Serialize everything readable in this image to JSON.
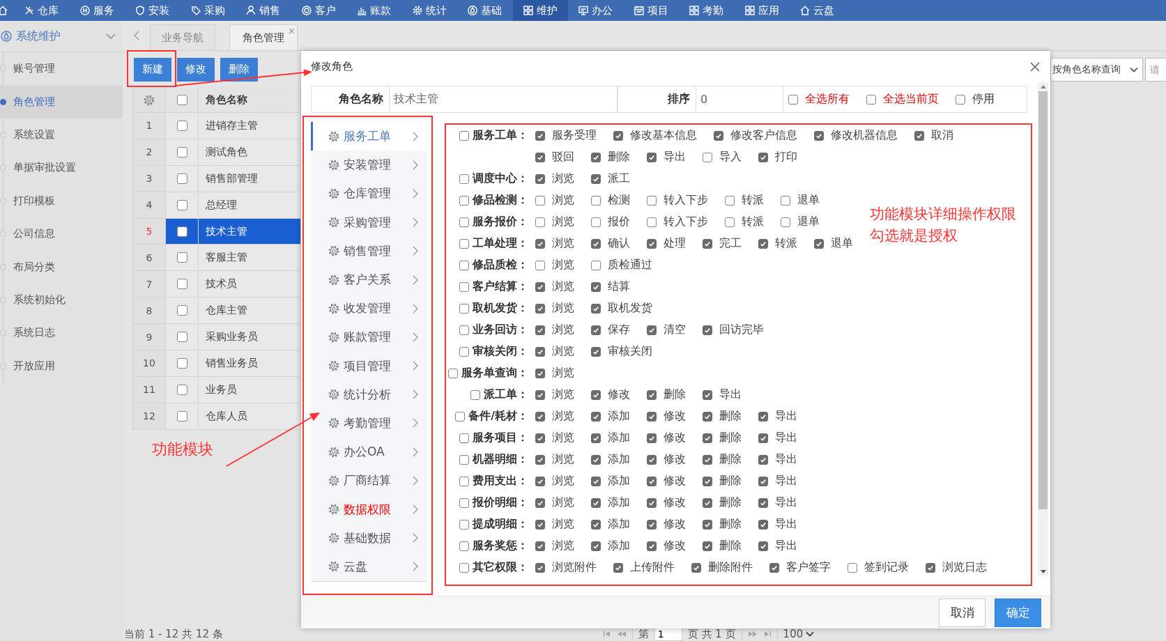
{
  "nav": [
    {
      "label": "仓库",
      "selected": false
    },
    {
      "label": "服务",
      "selected": false
    },
    {
      "label": "安装",
      "selected": false
    },
    {
      "label": "采购",
      "selected": false
    },
    {
      "label": "销售",
      "selected": false
    },
    {
      "label": "客户",
      "selected": false
    },
    {
      "label": "账款",
      "selected": false
    },
    {
      "label": "统计",
      "selected": false
    },
    {
      "label": "基础",
      "selected": false
    },
    {
      "label": "维护",
      "selected": true
    },
    {
      "label": "办公",
      "selected": false
    },
    {
      "label": "项目",
      "selected": false
    },
    {
      "label": "考勤",
      "selected": false
    },
    {
      "label": "应用",
      "selected": false
    },
    {
      "label": "云盘",
      "selected": false
    }
  ],
  "sidebar": {
    "title": "系统维护",
    "items": [
      {
        "label": "账号管理",
        "selected": false
      },
      {
        "label": "角色管理",
        "selected": true
      },
      {
        "label": "系统设置",
        "selected": false
      },
      {
        "label": "单据审批设置",
        "selected": false
      },
      {
        "label": "打印模板",
        "selected": false
      },
      {
        "label": "公司信息",
        "selected": false
      },
      {
        "label": "布局分类",
        "selected": false
      },
      {
        "label": "系统初始化",
        "selected": false
      },
      {
        "label": "系统日志",
        "selected": false
      },
      {
        "label": "开放应用",
        "selected": false
      }
    ]
  },
  "tabs": [
    {
      "label": "业务导航",
      "selected": false,
      "closable": false
    },
    {
      "label": "角色管理",
      "selected": true,
      "closable": true
    }
  ],
  "toolbar": {
    "buttons": [
      "新建",
      "修改",
      "删除"
    ],
    "search_select": "按角色名称查询",
    "search_field": {
      "placeholder": "请"
    }
  },
  "table": {
    "columns": [
      "角色名称"
    ],
    "header_checked": false,
    "rows": [
      {
        "number": "1",
        "name": "进销存主管",
        "checked": false,
        "selected": false
      },
      {
        "number": "2",
        "name": "测试角色",
        "checked": false,
        "selected": false
      },
      {
        "number": "3",
        "name": "销售部管理",
        "checked": false,
        "selected": false
      },
      {
        "number": "4",
        "name": "总经理",
        "checked": false,
        "selected": false
      },
      {
        "number": "5",
        "name": "技术主管",
        "checked": false,
        "selected": true
      },
      {
        "number": "6",
        "name": "客服主管",
        "checked": false,
        "selected": false
      },
      {
        "number": "7",
        "name": "技术员",
        "checked": false,
        "selected": false
      },
      {
        "number": "8",
        "name": "仓库主管",
        "checked": false,
        "selected": false
      },
      {
        "number": "9",
        "name": "采购业务员",
        "checked": false,
        "selected": false
      },
      {
        "number": "10",
        "name": "销售业务员",
        "checked": false,
        "selected": false
      },
      {
        "number": "11",
        "name": "业务员",
        "checked": false,
        "selected": false
      },
      {
        "number": "12",
        "name": "仓库人员",
        "checked": false,
        "selected": false
      }
    ]
  },
  "status_text": "当前 1 - 12 共 12 条",
  "pager": {
    "page_label": "第",
    "page": "1",
    "total_label": "页 共 1 页",
    "page_size": "100"
  },
  "dialog": {
    "title": "修改角色",
    "fields": [
      {
        "label": "角色名称",
        "value": "技术主管"
      },
      {
        "label": "排序",
        "value": "0"
      }
    ],
    "options": [
      {
        "label": "全选所有",
        "checked": false,
        "highlighted": true
      },
      {
        "label": "全选当前页",
        "checked": false,
        "highlighted": true
      },
      {
        "label": "停用",
        "checked": false,
        "highlighted": false
      }
    ],
    "modules": [
      {
        "label": "服务工单",
        "selected": true,
        "highlighted": false
      },
      {
        "label": "安装管理",
        "selected": false,
        "highlighted": false
      },
      {
        "label": "仓库管理",
        "selected": false,
        "highlighted": false
      },
      {
        "label": "采购管理",
        "selected": false,
        "highlighted": false
      },
      {
        "label": "销售管理",
        "selected": false,
        "highlighted": false
      },
      {
        "label": "客户关系",
        "selected": false,
        "highlighted": false
      },
      {
        "label": "收发管理",
        "selected": false,
        "highlighted": false
      },
      {
        "label": "账款管理",
        "selected": false,
        "highlighted": false
      },
      {
        "label": "项目管理",
        "selected": false,
        "highlighted": false
      },
      {
        "label": "统计分析",
        "selected": false,
        "highlighted": false
      },
      {
        "label": "考勤管理",
        "selected": false,
        "highlighted": false
      },
      {
        "label": "办公OA",
        "selected": false,
        "highlighted": false
      },
      {
        "label": "厂商结算",
        "selected": false,
        "highlighted": false
      },
      {
        "label": "数据权限",
        "selected": false,
        "highlighted": true
      },
      {
        "label": "基础数据",
        "selected": false,
        "highlighted": false
      },
      {
        "label": "云盘",
        "selected": false,
        "highlighted": false
      }
    ],
    "permissions": [
      {
        "label": "服务工单：",
        "checked": false,
        "lines": [
          [
            {
              "label": "服务受理",
              "checked": true
            },
            {
              "label": "修改基本信息",
              "checked": true
            },
            {
              "label": "修改客户信息",
              "checked": true
            },
            {
              "label": "修改机器信息",
              "checked": true
            },
            {
              "label": "取消",
              "checked": true
            }
          ],
          [
            {
              "label": "驳回",
              "checked": true
            },
            {
              "label": "删除",
              "checked": true
            },
            {
              "label": "导出",
              "checked": true
            },
            {
              "label": "导入",
              "checked": false
            },
            {
              "label": "打印",
              "checked": true
            }
          ]
        ]
      },
      {
        "label": "调度中心：",
        "checked": false,
        "lines": [
          [
            {
              "label": "浏览",
              "checked": true
            },
            {
              "label": "派工",
              "checked": true
            }
          ]
        ]
      },
      {
        "label": "修品检测：",
        "checked": false,
        "lines": [
          [
            {
              "label": "浏览",
              "checked": false
            },
            {
              "label": "检测",
              "checked": false
            },
            {
              "label": "转入下步",
              "checked": false
            },
            {
              "label": "转派",
              "checked": false
            },
            {
              "label": "退单",
              "checked": false
            }
          ]
        ]
      },
      {
        "label": "服务报价：",
        "checked": false,
        "lines": [
          [
            {
              "label": "浏览",
              "checked": false
            },
            {
              "label": "报价",
              "checked": false
            },
            {
              "label": "转入下步",
              "checked": false
            },
            {
              "label": "转派",
              "checked": false
            },
            {
              "label": "退单",
              "checked": false
            }
          ]
        ]
      },
      {
        "label": "工单处理：",
        "checked": false,
        "lines": [
          [
            {
              "label": "浏览",
              "checked": true
            },
            {
              "label": "确认",
              "checked": true
            },
            {
              "label": "处理",
              "checked": true
            },
            {
              "label": "完工",
              "checked": true
            },
            {
              "label": "转派",
              "checked": true
            },
            {
              "label": "退单",
              "checked": true
            }
          ]
        ]
      },
      {
        "label": "修品质检：",
        "checked": false,
        "lines": [
          [
            {
              "label": "浏览",
              "checked": false
            },
            {
              "label": "质检通过",
              "checked": false
            }
          ]
        ]
      },
      {
        "label": "客户结算：",
        "checked": false,
        "lines": [
          [
            {
              "label": "浏览",
              "checked": true
            },
            {
              "label": "结算",
              "checked": true
            }
          ]
        ]
      },
      {
        "label": "取机发货：",
        "checked": false,
        "lines": [
          [
            {
              "label": "浏览",
              "checked": true
            },
            {
              "label": "取机发货",
              "checked": true
            }
          ]
        ]
      },
      {
        "label": "业务回访：",
        "checked": false,
        "lines": [
          [
            {
              "label": "浏览",
              "checked": true
            },
            {
              "label": "保存",
              "checked": true
            },
            {
              "label": "清空",
              "checked": true
            },
            {
              "label": "回访完毕",
              "checked": true
            }
          ]
        ]
      },
      {
        "label": "审核关闭：",
        "checked": false,
        "lines": [
          [
            {
              "label": "浏览",
              "checked": true
            },
            {
              "label": "审核关闭",
              "checked": true
            }
          ]
        ]
      },
      {
        "label": "服务单查询：",
        "checked": false,
        "lines": [
          [
            {
              "label": "浏览",
              "checked": true
            }
          ]
        ]
      },
      {
        "label": "派工单：",
        "checked": false,
        "lines": [
          [
            {
              "label": "浏览",
              "checked": true
            },
            {
              "label": "修改",
              "checked": true
            },
            {
              "label": "删除",
              "checked": true
            },
            {
              "label": "导出",
              "checked": true
            }
          ]
        ]
      },
      {
        "label": "备件/耗材：",
        "checked": false,
        "lines": [
          [
            {
              "label": "浏览",
              "checked": true
            },
            {
              "label": "添加",
              "checked": true
            },
            {
              "label": "修改",
              "checked": true
            },
            {
              "label": "删除",
              "checked": true
            },
            {
              "label": "导出",
              "checked": true
            }
          ]
        ]
      },
      {
        "label": "服务项目：",
        "checked": false,
        "lines": [
          [
            {
              "label": "浏览",
              "checked": true
            },
            {
              "label": "添加",
              "checked": true
            },
            {
              "label": "修改",
              "checked": true
            },
            {
              "label": "删除",
              "checked": true
            },
            {
              "label": "导出",
              "checked": true
            }
          ]
        ]
      },
      {
        "label": "机器明细：",
        "checked": false,
        "lines": [
          [
            {
              "label": "浏览",
              "checked": true
            },
            {
              "label": "添加",
              "checked": true
            },
            {
              "label": "修改",
              "checked": true
            },
            {
              "label": "删除",
              "checked": true
            },
            {
              "label": "导出",
              "checked": true
            }
          ]
        ]
      },
      {
        "label": "费用支出：",
        "checked": false,
        "lines": [
          [
            {
              "label": "浏览",
              "checked": true
            },
            {
              "label": "添加",
              "checked": true
            },
            {
              "label": "修改",
              "checked": true
            },
            {
              "label": "删除",
              "checked": true
            },
            {
              "label": "导出",
              "checked": true
            }
          ]
        ]
      },
      {
        "label": "报价明细：",
        "checked": false,
        "lines": [
          [
            {
              "label": "浏览",
              "checked": true
            },
            {
              "label": "添加",
              "checked": true
            },
            {
              "label": "修改",
              "checked": true
            },
            {
              "label": "删除",
              "checked": true
            },
            {
              "label": "导出",
              "checked": true
            }
          ]
        ]
      },
      {
        "label": "提成明细：",
        "checked": false,
        "lines": [
          [
            {
              "label": "浏览",
              "checked": true
            },
            {
              "label": "添加",
              "checked": true
            },
            {
              "label": "修改",
              "checked": true
            },
            {
              "label": "删除",
              "checked": true
            },
            {
              "label": "导出",
              "checked": true
            }
          ]
        ]
      },
      {
        "label": "服务奖惩：",
        "checked": false,
        "lines": [
          [
            {
              "label": "浏览",
              "checked": true
            },
            {
              "label": "添加",
              "checked": true
            },
            {
              "label": "修改",
              "checked": true
            },
            {
              "label": "删除",
              "checked": true
            },
            {
              "label": "导出",
              "checked": true
            }
          ]
        ]
      },
      {
        "label": "其它权限：",
        "checked": false,
        "lines": [
          [
            {
              "label": "浏览附件",
              "checked": true
            },
            {
              "label": "上传附件",
              "checked": true
            },
            {
              "label": "删除附件",
              "checked": true
            },
            {
              "label": "客户签字",
              "checked": true
            },
            {
              "label": "签到记录",
              "checked": false
            },
            {
              "label": "浏览日志",
              "checked": true
            }
          ]
        ]
      }
    ],
    "buttons": [
      {
        "label": "取消",
        "kind": "secondary"
      },
      {
        "label": "确定",
        "kind": "primary"
      }
    ]
  },
  "annotations": {
    "module_label": "功能模块",
    "note": [
      "功能模块详细操作权限",
      "勾选就是授权"
    ]
  }
}
